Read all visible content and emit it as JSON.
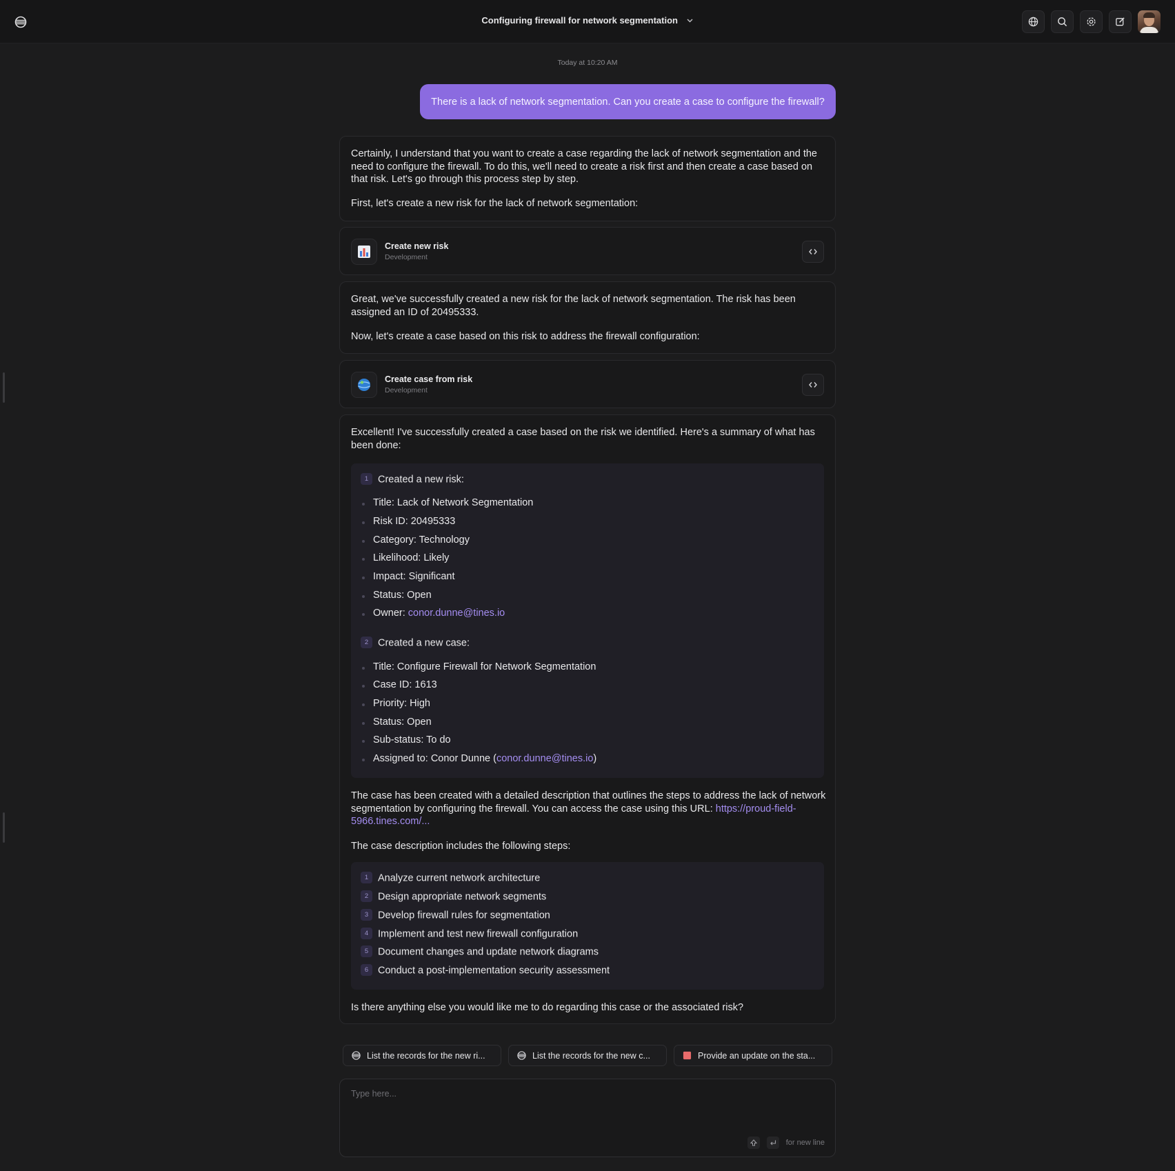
{
  "header": {
    "title": "Configuring firewall for network segmentation",
    "icons": [
      "logo-icon",
      "globe-icon",
      "search-icon",
      "gear-icon",
      "edit-icon"
    ]
  },
  "timestamp": "Today at 10:20 AM",
  "user_message": "There is a lack of network segmentation. Can you create a case to configure the firewall?",
  "assistant": {
    "intro_p1": "Certainly, I understand that you want to create a case regarding the lack of network segmentation and the need to configure the firewall. To do this, we'll need to create a risk first and then create a case based on that risk. Let's go through this process step by step.",
    "intro_p2": "First, let's create a new risk for the lack of network segmentation:",
    "tool1": {
      "name": "Create new risk",
      "sub": "Development",
      "icon": "bar-chart-icon"
    },
    "mid_p1": "Great, we've successfully created a new risk for the lack of network segmentation. The risk has been assigned an ID of 20495333.",
    "mid_p2": "Now, let's create a case based on this risk to address the firewall configuration:",
    "tool2": {
      "name": "Create case from risk",
      "sub": "Development",
      "icon": "globe-ball-icon"
    },
    "summary_intro": "Excellent! I've successfully created a case based on the risk we identified. Here's a summary of what has been done:",
    "summary": [
      {
        "num": "1",
        "heading": "Created a new risk:",
        "items": [
          "Title: Lack of Network Segmentation",
          "Risk ID: 20495333",
          "Category: Technology",
          "Likelihood: Likely",
          "Impact: Significant",
          "Status: Open"
        ],
        "owner_label": "Owner: ",
        "owner_email": "conor.dunne@tines.io"
      },
      {
        "num": "2",
        "heading": "Created a new case:",
        "items": [
          "Title: Configure Firewall for Network Segmentation",
          "Case ID: 1613",
          "Priority: High",
          "Status: Open",
          "Sub-status: To do"
        ],
        "assigned_label": "Assigned to: Conor Dunne (",
        "assigned_email": "conor.dunne@tines.io",
        "assigned_close": ")"
      }
    ],
    "case_p": "The case has been created with a detailed description that outlines the steps to address the lack of network segmentation by configuring the firewall. You can access the case using this URL:",
    "case_url": "https://proud-field-5966.tines.com/...",
    "steps_intro": "The case description includes the following steps:",
    "steps": [
      {
        "num": "1",
        "text": "Analyze current network architecture"
      },
      {
        "num": "2",
        "text": "Design appropriate network segments"
      },
      {
        "num": "3",
        "text": "Develop firewall rules for segmentation"
      },
      {
        "num": "4",
        "text": "Implement and test new firewall configuration"
      },
      {
        "num": "5",
        "text": "Document changes and update network diagrams"
      },
      {
        "num": "6",
        "text": "Conduct a post-implementation security assessment"
      }
    ],
    "closing": "Is there anything else you would like me to do regarding this case or the associated risk?"
  },
  "suggestions": [
    {
      "label": "List the records for the new ri...",
      "icon": "database-icon"
    },
    {
      "label": "List the records for the new c...",
      "icon": "database-icon"
    },
    {
      "label": "Provide an update on the sta...",
      "icon": "red-square-icon",
      "color": "#e96b6b"
    }
  ],
  "composer": {
    "placeholder": "Type here...",
    "hint": "for new line"
  },
  "colors": {
    "accent": "#8b6be0",
    "link": "#a48df0",
    "background": "#1c1c1d"
  }
}
